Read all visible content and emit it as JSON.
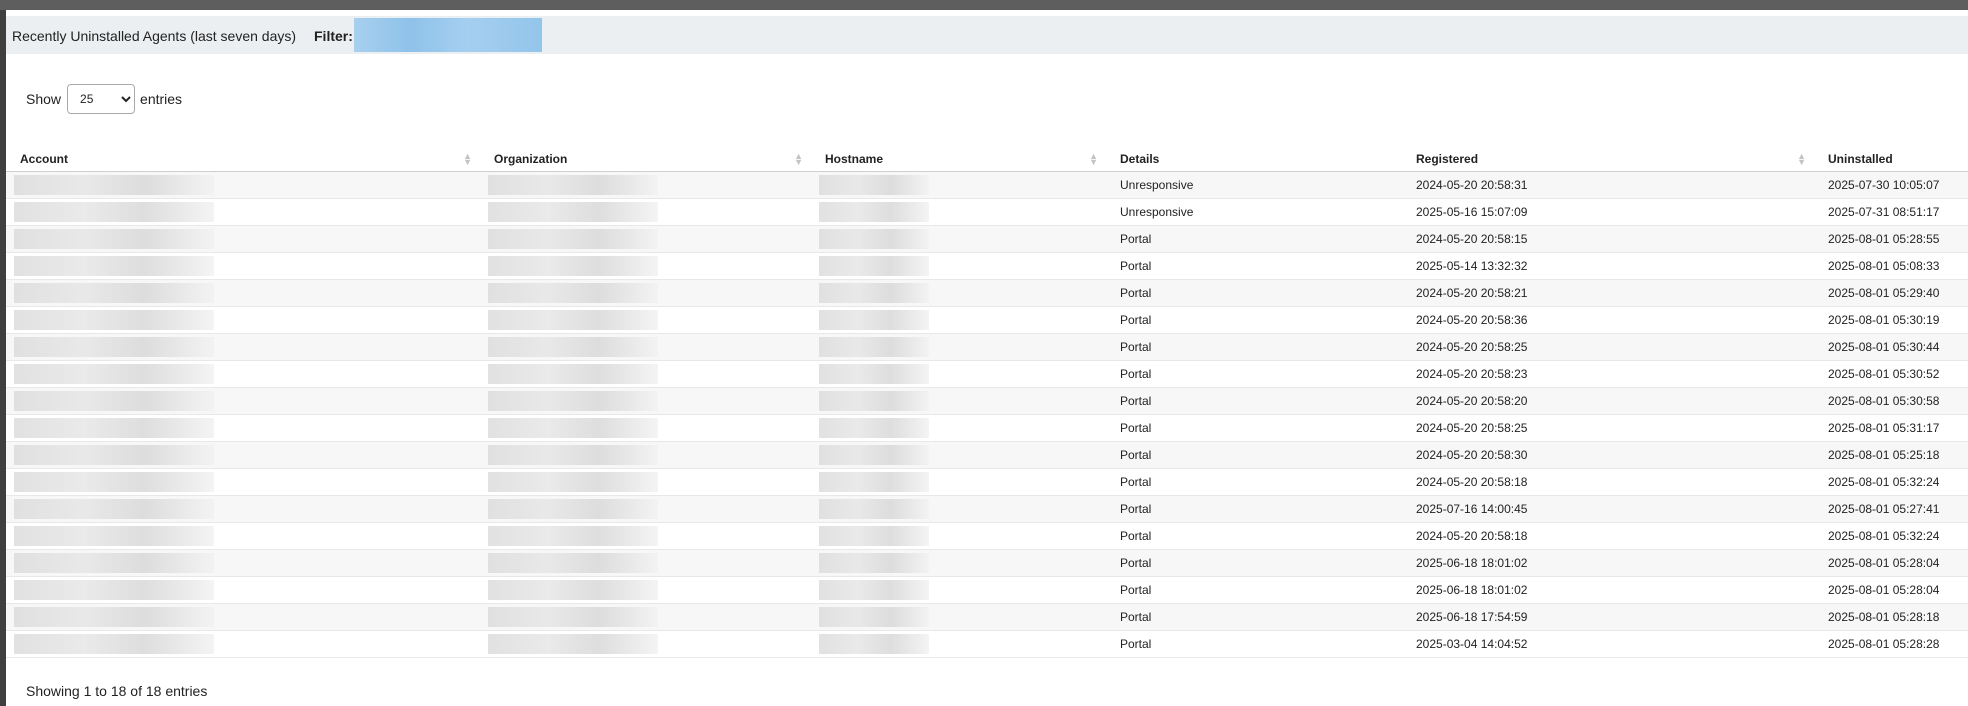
{
  "panel": {
    "title": "Recently Uninstalled Agents (last seven days)",
    "filter_label": "Filter:",
    "filter_value": ""
  },
  "length_menu": {
    "show_label": "Show",
    "selected": "25",
    "entries_label": "entries"
  },
  "table": {
    "columns": [
      "Account",
      "Organization",
      "Hostname",
      "Details",
      "Registered",
      "Uninstalled"
    ],
    "rows": [
      {
        "details": "Unresponsive",
        "registered": "2024-05-20 20:58:31",
        "uninstalled": "2025-07-30 10:05:07"
      },
      {
        "details": "Unresponsive",
        "registered": "2025-05-16 15:07:09",
        "uninstalled": "2025-07-31 08:51:17"
      },
      {
        "details": "Portal",
        "registered": "2024-05-20 20:58:15",
        "uninstalled": "2025-08-01 05:28:55"
      },
      {
        "details": "Portal",
        "registered": "2025-05-14 13:32:32",
        "uninstalled": "2025-08-01 05:08:33"
      },
      {
        "details": "Portal",
        "registered": "2024-05-20 20:58:21",
        "uninstalled": "2025-08-01 05:29:40"
      },
      {
        "details": "Portal",
        "registered": "2024-05-20 20:58:36",
        "uninstalled": "2025-08-01 05:30:19"
      },
      {
        "details": "Portal",
        "registered": "2024-05-20 20:58:25",
        "uninstalled": "2025-08-01 05:30:44"
      },
      {
        "details": "Portal",
        "registered": "2024-05-20 20:58:23",
        "uninstalled": "2025-08-01 05:30:52"
      },
      {
        "details": "Portal",
        "registered": "2024-05-20 20:58:20",
        "uninstalled": "2025-08-01 05:30:58"
      },
      {
        "details": "Portal",
        "registered": "2024-05-20 20:58:25",
        "uninstalled": "2025-08-01 05:31:17"
      },
      {
        "details": "Portal",
        "registered": "2024-05-20 20:58:30",
        "uninstalled": "2025-08-01 05:25:18"
      },
      {
        "details": "Portal",
        "registered": "2024-05-20 20:58:18",
        "uninstalled": "2025-08-01 05:32:24"
      },
      {
        "details": "Portal",
        "registered": "2025-07-16 14:00:45",
        "uninstalled": "2025-08-01 05:27:41"
      },
      {
        "details": "Portal",
        "registered": "2024-05-20 20:58:18",
        "uninstalled": "2025-08-01 05:32:24"
      },
      {
        "details": "Portal",
        "registered": "2025-06-18 18:01:02",
        "uninstalled": "2025-08-01 05:28:04"
      },
      {
        "details": "Portal",
        "registered": "2025-06-18 18:01:02",
        "uninstalled": "2025-08-01 05:28:04"
      },
      {
        "details": "Portal",
        "registered": "2025-06-18 17:54:59",
        "uninstalled": "2025-08-01 05:28:18"
      },
      {
        "details": "Portal",
        "registered": "2025-03-04 14:04:52",
        "uninstalled": "2025-08-01 05:28:28"
      }
    ]
  },
  "footer": {
    "info": "Showing 1 to 18 of 18 entries"
  },
  "icons": {
    "sort": "sort-both-icon"
  }
}
